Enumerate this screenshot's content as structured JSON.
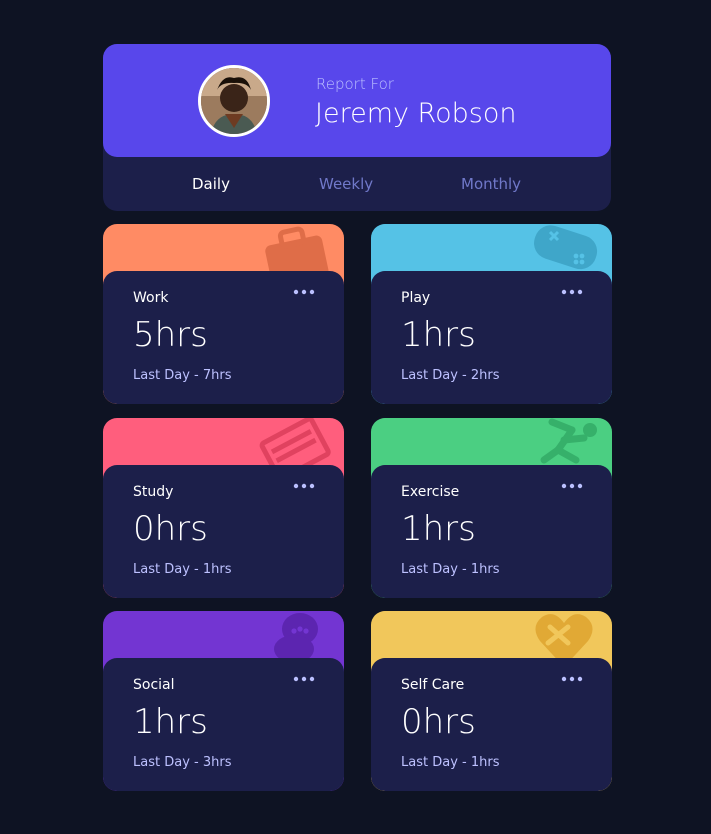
{
  "profile": {
    "report_label": "Report For",
    "name": "Jeremy Robson",
    "tabs": [
      {
        "label": "Daily",
        "active": true
      },
      {
        "label": "Weekly",
        "active": false
      },
      {
        "label": "Monthly",
        "active": false
      }
    ]
  },
  "cards": [
    {
      "title": "Work",
      "current": "5hrs",
      "previous": "Last Day - 7hrs",
      "color": "#ff8b64",
      "icon": "briefcase-icon"
    },
    {
      "title": "Play",
      "current": "1hrs",
      "previous": "Last Day - 2hrs",
      "color": "#55c2e6",
      "icon": "gamepad-icon"
    },
    {
      "title": "Study",
      "current": "0hrs",
      "previous": "Last Day - 1hrs",
      "color": "#ff5e7d",
      "icon": "books-icon"
    },
    {
      "title": "Exercise",
      "current": "1hrs",
      "previous": "Last Day - 1hrs",
      "color": "#4bcf82",
      "icon": "running-person-icon"
    },
    {
      "title": "Social",
      "current": "1hrs",
      "previous": "Last Day - 3hrs",
      "color": "#7335d2",
      "icon": "chat-bubbles-icon"
    },
    {
      "title": "Self Care",
      "current": "0hrs",
      "previous": "Last Day - 1hrs",
      "color": "#f1c75b",
      "icon": "heart-bandage-icon"
    }
  ],
  "colors": {
    "background": "#0e1323",
    "card_body": "#1c1f4a",
    "accent": "#5847eb",
    "muted_text": "#bdc1ff",
    "inactive_tab": "#7078c9"
  }
}
